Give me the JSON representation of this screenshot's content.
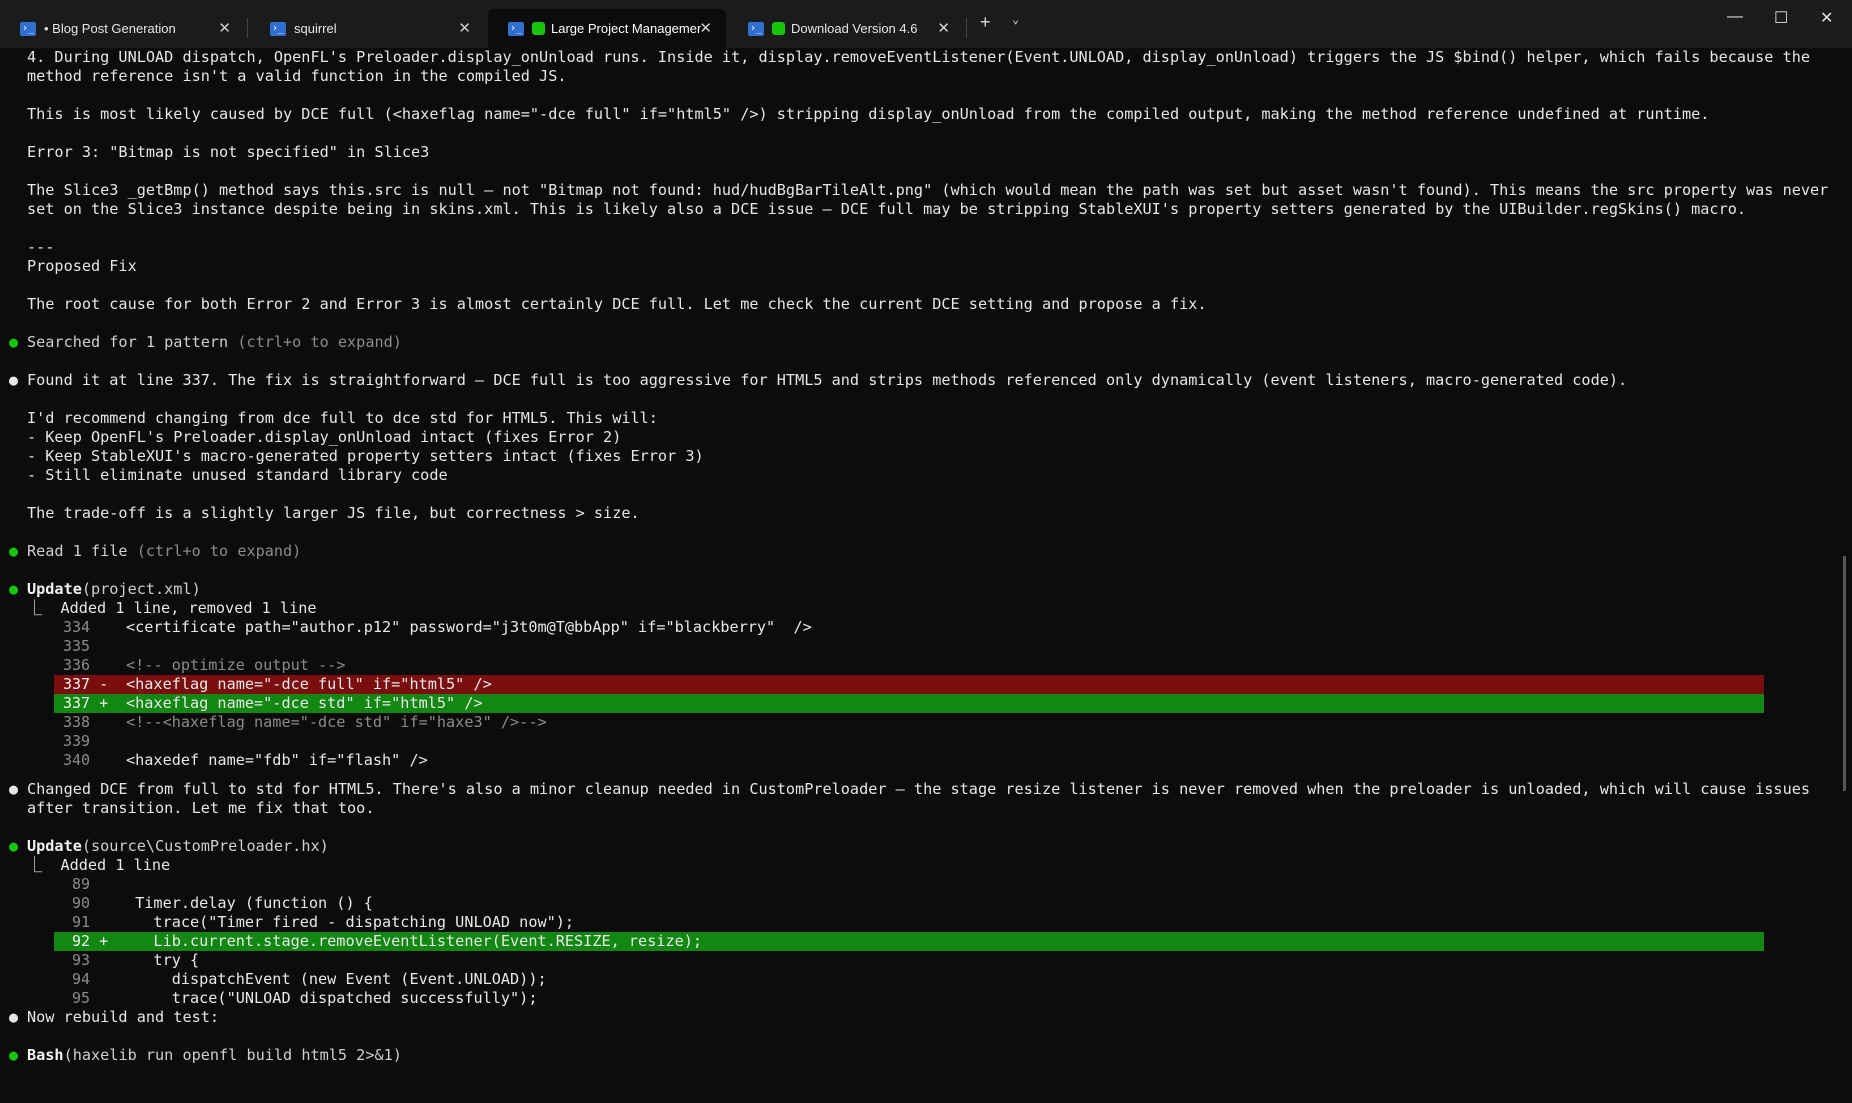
{
  "tabs": [
    {
      "label": "• Blog Post Generation",
      "icon": "powershell-icon"
    },
    {
      "label": "squirrel",
      "icon": "powershell-icon"
    },
    {
      "label": "Large Project Managemen",
      "icon": "powershell-icon",
      "active": true
    },
    {
      "label": "Download Version 4.6",
      "icon": "powershell-icon"
    }
  ],
  "window": {
    "minimize": "—",
    "maximize": "☐",
    "close": "✕",
    "newtab": "+",
    "dropdown": "⌄"
  },
  "lines": {
    "l1a": "4. During UNLOAD dispatch, OpenFL's Preloader.display_onUnload runs. Inside it, display.removeEventListener(Event.UNLOAD, display_onUnload) triggers the JS $bind() helper, which fails because the",
    "l1b": "method reference isn't a valid function in the compiled JS.",
    "l2": "This is most likely caused by DCE full (<haxeflag name=\"-dce full\" if=\"html5\" />) stripping display_onUnload from the compiled output, making the method reference undefined at runtime.",
    "l3": "Error 3: \"Bitmap is not specified\" in Slice3",
    "l4a": "The Slice3 _getBmp() method says this.src is null — not \"Bitmap not found: hud/hudBgBarTileAlt.png\" (which would mean the path was set but asset wasn't found). This means the src property was never",
    "l4b": "set on the Slice3 instance despite being in skins.xml. This is likely also a DCE issue — DCE full may be stripping StableXUI's property setters generated by the UIBuilder.regSkins() macro.",
    "sep": "---",
    "l5": "Proposed Fix",
    "l6": "The root cause for both Error 2 and Error 3 is almost certainly DCE full. Let me check the current DCE setting and propose a fix.",
    "search": "Searched for 1 pattern",
    "expand1": " (ctrl+o to expand)",
    "found": "Found it at line 337. The fix is straightforward — DCE full is too aggressive for HTML5 and strips methods referenced only dynamically (event listeners, macro-generated code).",
    "rec": "I'd recommend changing from dce full to dce std for HTML5. This will:",
    "r1": "- Keep OpenFL's Preloader.display_onUnload intact (fixes Error 2)",
    "r2": "- Keep StableXUI's macro-generated property setters intact (fixes Error 3)",
    "r3": "- Still eliminate unused standard library code",
    "trade": "The trade-off is a slightly larger JS file, but correctness > size.",
    "read": "Read 1 file",
    "expand2": " (ctrl+o to expand)",
    "upd1": "Update",
    "upd1arg": "(project.xml)",
    "upd1sum": "⎿  Added 1 line, removed 1 line",
    "changed_a": "Changed DCE from full to std for HTML5. There's also a minor cleanup needed in CustomPreloader — the stage resize listener is never removed when the preloader is unloaded, which will cause issues",
    "changed_b": "after transition. Let me fix that too.",
    "upd2": "Update",
    "upd2arg": "(source\\CustomPreloader.hx)",
    "upd2sum": "⎿  Added 1 line",
    "rebuild": "Now rebuild and test:",
    "bash": "Bash",
    "basharg": "(haxelib run openfl build html5 2>&1)"
  },
  "diff1": [
    {
      "n": "334",
      "sign": " ",
      "code": "<certificate path=\"author.p12\" password=\"j3t0m@T@bbApp\" if=\"blackberry\"  />"
    },
    {
      "n": "335",
      "sign": " ",
      "code": ""
    },
    {
      "n": "336",
      "sign": " ",
      "code": "<!-- optimize output -->"
    },
    {
      "n": "337",
      "sign": "-",
      "code": "<haxeflag name=\"-dce full\" if=\"html5\" />"
    },
    {
      "n": "337",
      "sign": "+",
      "code": "<haxeflag name=\"-dce std\" if=\"html5\" />"
    },
    {
      "n": "338",
      "sign": " ",
      "code": "<!--<haxeflag name=\"-dce std\" if=\"haxe3\" />-->"
    },
    {
      "n": "339",
      "sign": " ",
      "code": ""
    },
    {
      "n": "340",
      "sign": " ",
      "code": "<haxedef name=\"fdb\" if=\"flash\" />"
    }
  ],
  "diff2": [
    {
      "n": "89",
      "sign": " ",
      "code": ""
    },
    {
      "n": "90",
      "sign": " ",
      "code": " Timer.delay (function () {"
    },
    {
      "n": "91",
      "sign": " ",
      "code": "   trace(\"Timer fired - dispatching UNLOAD now\");"
    },
    {
      "n": "92",
      "sign": "+",
      "code": "   Lib.current.stage.removeEventListener(Event.RESIZE, resize);"
    },
    {
      "n": "93",
      "sign": " ",
      "code": "   try {"
    },
    {
      "n": "94",
      "sign": " ",
      "code": "     dispatchEvent (new Event (Event.UNLOAD));"
    },
    {
      "n": "95",
      "sign": " ",
      "code": "     trace(\"UNLOAD dispatched successfully\");"
    }
  ],
  "colors": {
    "bg": "#0c0c0c",
    "del": "#7a0e0e",
    "add": "#128712",
    "bullet": "#16c60c"
  }
}
